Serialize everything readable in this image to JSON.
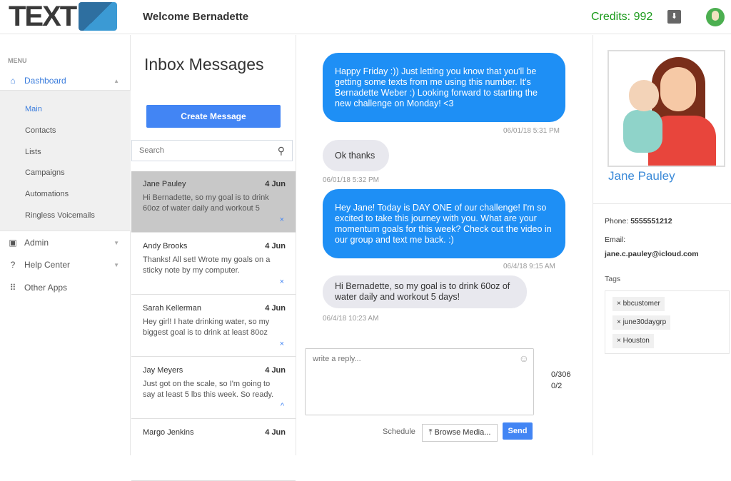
{
  "header": {
    "logo_text": "TEXT",
    "logo_mark": "2",
    "welcome": "Welcome Bernadette",
    "credits": "Credits: 992",
    "icons": [
      "inbox-download-icon",
      "user-avatar"
    ]
  },
  "sidebar": {
    "menu_label": "MENU",
    "dashboard": {
      "label": "Dashboard",
      "icon": "home-icon"
    },
    "sub_items": [
      "Main",
      "Contacts",
      "Lists",
      "Campaigns",
      "Automations",
      "Ringless Voicemails"
    ],
    "items": [
      {
        "label": "Admin",
        "icon": "android-icon"
      },
      {
        "label": "Help Center",
        "icon": "help-icon"
      },
      {
        "label": "Other Apps",
        "icon": "apps-grid-icon"
      }
    ]
  },
  "inbox": {
    "title": "Inbox Messages",
    "create_label": "Create Message",
    "search_placeholder": "Search",
    "messages": [
      {
        "name": "Jane Pauley",
        "date": "4 Jun",
        "preview": "Hi Bernadette, so my goal is  to drink 60oz of water daily and workout  5",
        "mark": "×"
      },
      {
        "name": "Andy Brooks",
        "date": "4 Jun",
        "preview": "Thanks! All set! Wrote my goals on a sticky note by my computer.",
        "mark": "×"
      },
      {
        "name": "Sarah Kellerman",
        "date": "4 Jun",
        "preview": "Hey girl! I hate drinking water, so my biggest goal is to drink at least 80oz",
        "mark": "×"
      },
      {
        "name": "Jay Meyers",
        "date": "4 Jun",
        "preview": "Just got on the scale, so I'm going to say at least 5 lbs this week. So ready.",
        "mark": "^"
      },
      {
        "name": "Margo Jenkins",
        "date": "4 Jun",
        "preview": "",
        "mark": ""
      }
    ]
  },
  "chat": {
    "messages": [
      {
        "dir": "out",
        "text": "Happy Friday :)) Just letting you know that you'll be getting some texts from me using this number. It's Bernadette Weber :) Looking forward to starting the new challenge on Monday! <3",
        "time": "06/01/18 5:31 PM"
      },
      {
        "dir": "in",
        "text": "Ok thanks",
        "time": "06/01/18 5:32 PM"
      },
      {
        "dir": "out",
        "text": "Hey Jane! Today is DAY ONE of our challenge! I'm so excited to take this journey with you. What are your momentum goals for this week? Check out the video in our group and text me back. :)",
        "time": "06/4/18 9:15 AM"
      },
      {
        "dir": "in",
        "text": "Hi Bernadette, so my goal is to drink 60oz of water daily and workout 5 days!",
        "time": "06/4/18 10:23 AM"
      }
    ],
    "reply_placeholder": "write a reply...",
    "char_count": "0/306",
    "segment_count": "0/2",
    "schedule_label": "Schedule",
    "browse_label": "Browse Media...",
    "send_label": "Send"
  },
  "contact": {
    "name": "Jane Pauley",
    "phone_label": "Phone:",
    "phone": "5555551212",
    "email_label": "Email:",
    "email": "jane.c.pauley@icloud.com",
    "tags_label": "Tags",
    "tags": [
      "bbcustomer",
      "june30daygrp",
      "Houston"
    ]
  },
  "colors": {
    "accent": "#4285f4",
    "outgoing_bubble": "#1e8ff5",
    "credits": "#1a9a1a",
    "selected_row": "#c8c8c8"
  }
}
